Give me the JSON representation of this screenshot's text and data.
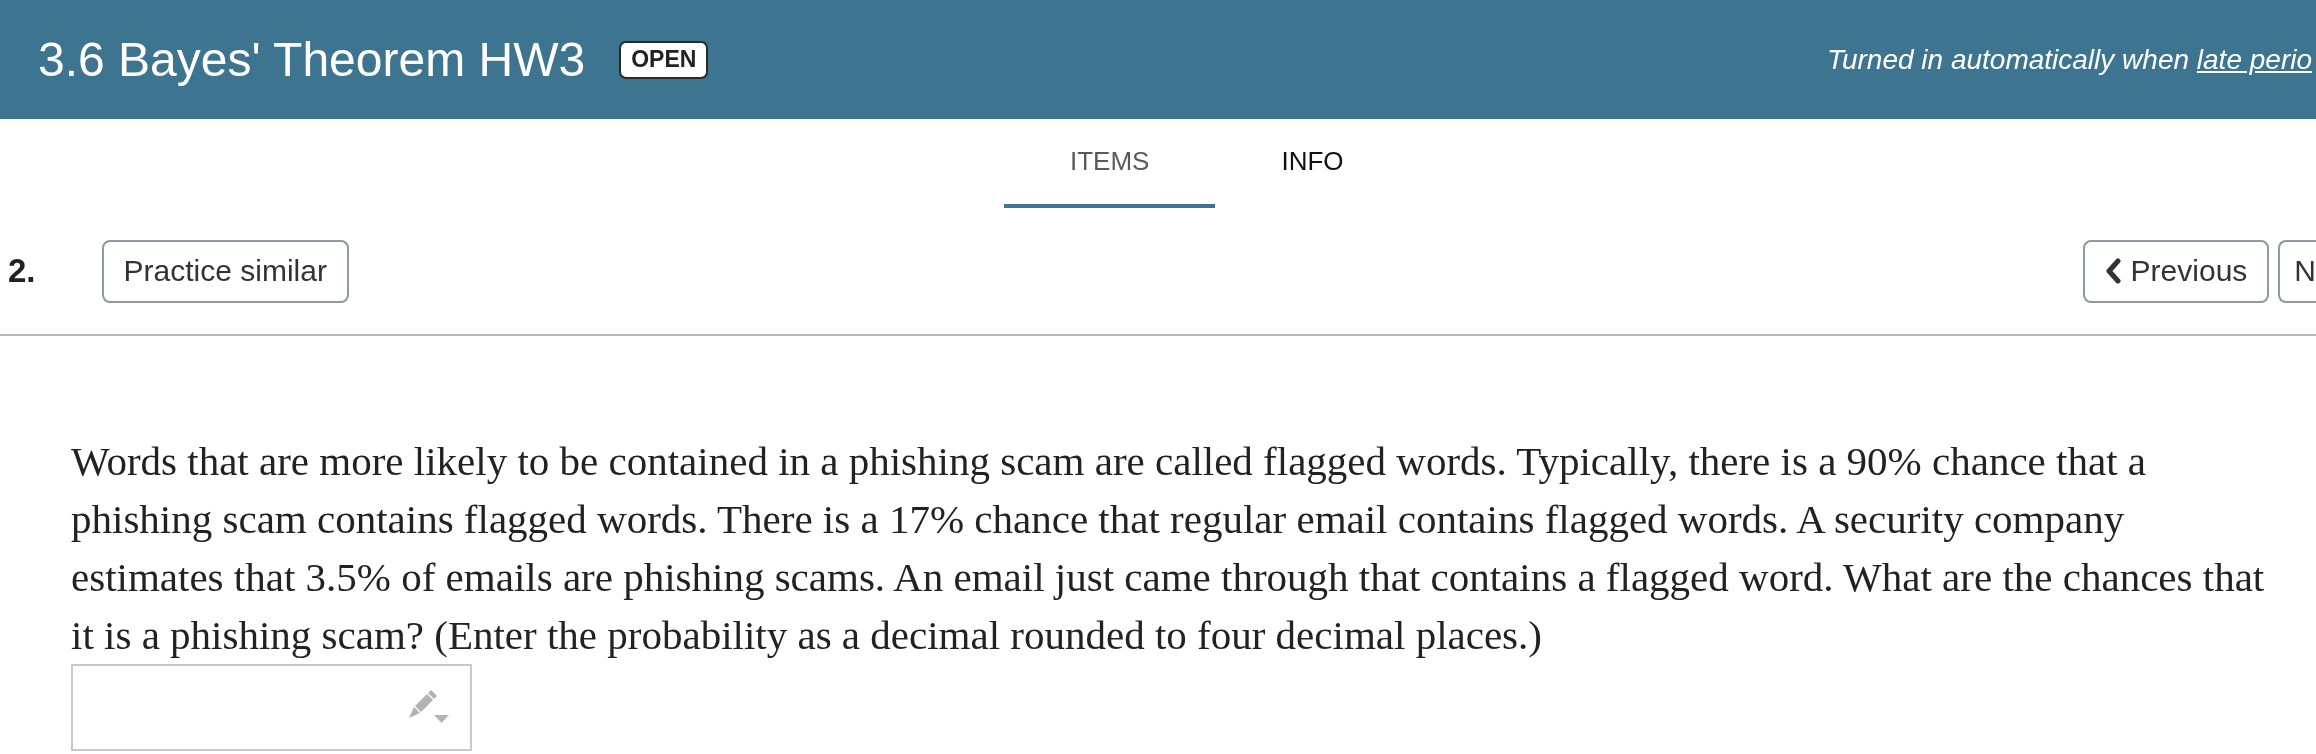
{
  "header": {
    "title": "3.6 Bayes' Theorem HW3",
    "badge": "OPEN",
    "notice": {
      "text": "Turned in automatically when ",
      "link": "late perio"
    }
  },
  "tabs": [
    {
      "label": "ITEMS",
      "selected": true
    },
    {
      "label": "INFO",
      "selected": false
    }
  ],
  "question": {
    "number": "2.",
    "practice_button": "Practice similar",
    "nav_buttons": [
      {
        "kind": "previous",
        "label": "Previous"
      },
      {
        "kind": "next",
        "label": "N"
      }
    ],
    "text": "Words that are more likely to be contained in a phishing scam are called flagged words. Typically, there is a 90% chance that a\nphishing scam contains flagged words. There is a 17% chance that regular email contains flagged words. A security company\nestimates that 3.5% of emails are phishing scams. An email just came through that contains a flagged word. What are the chances that\nit is a phishing scam? (Enter the probability as a decimal rounded to four decimal places.)"
  }
}
